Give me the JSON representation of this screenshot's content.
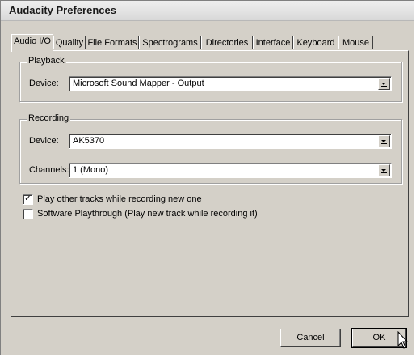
{
  "window": {
    "title": "Audacity Preferences"
  },
  "tabs": [
    {
      "label": "Audio I/O",
      "active": true
    },
    {
      "label": "Quality"
    },
    {
      "label": "File Formats"
    },
    {
      "label": "Spectrograms"
    },
    {
      "label": "Directories"
    },
    {
      "label": "Interface"
    },
    {
      "label": "Keyboard"
    },
    {
      "label": "Mouse"
    }
  ],
  "playback": {
    "legend": "Playback",
    "device_label": "Device:",
    "device_value": "Microsoft Sound Mapper - Output"
  },
  "recording": {
    "legend": "Recording",
    "device_label": "Device:",
    "device_value": "AK5370",
    "channels_label": "Channels:",
    "channels_value": "1 (Mono)"
  },
  "options": [
    {
      "label": "Play other tracks while recording new one",
      "checked": true
    },
    {
      "label": "Software Playthrough (Play new track while recording it)",
      "checked": false
    }
  ],
  "buttons": {
    "cancel": "Cancel",
    "ok": "OK"
  },
  "icons": {
    "checkmark": "✓",
    "cursor": "arrow-pointer-icon"
  }
}
